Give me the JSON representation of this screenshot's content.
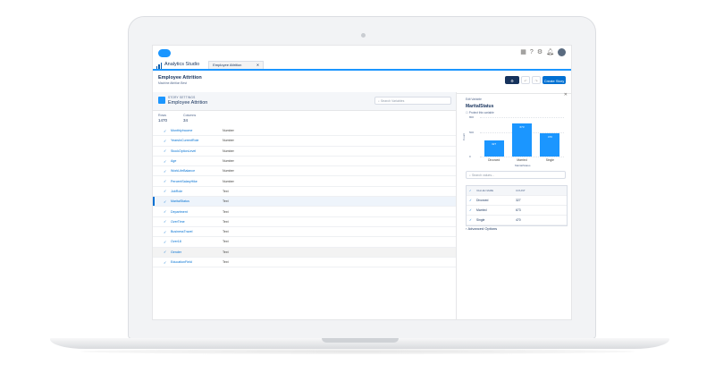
{
  "app": {
    "title": "Analytics Studio",
    "tab_label": "Employee Attrition",
    "tab_close": "✕",
    "icons": [
      "app-launcher-icon",
      "help-icon",
      "gear-icon",
      "bell-icon",
      "avatar"
    ]
  },
  "header": {
    "title": "Employee Attrition",
    "subtitle": "Machine Attrition Best",
    "buttons": [
      "",
      "",
      "",
      "Create Story"
    ]
  },
  "story": {
    "label": "STORY SETTINGS",
    "title": "Employee Attrition",
    "search_placeholder": "Search Variables"
  },
  "stats": {
    "rows_label": "Rows",
    "rows_value": "1470",
    "columns_label": "Columns",
    "columns_value": "34"
  },
  "variables": [
    {
      "name": "MonthlyIncome",
      "type": "Number"
    },
    {
      "name": "YearsInCurrentRole",
      "type": "Number"
    },
    {
      "name": "StockOptionLevel",
      "type": "Number"
    },
    {
      "name": "Age",
      "type": "Number"
    },
    {
      "name": "WorkLifeBalance",
      "type": "Number"
    },
    {
      "name": "PercentSalaryHike",
      "type": "Number"
    },
    {
      "name": "JobRole",
      "type": "Text"
    },
    {
      "name": "MaritalStatus",
      "type": "Text"
    },
    {
      "name": "Department",
      "type": "Text"
    },
    {
      "name": "OverTime",
      "type": "Text"
    },
    {
      "name": "BusinessTravel",
      "type": "Text"
    },
    {
      "name": "Over18",
      "type": "Text"
    },
    {
      "name": "Gender",
      "type": "Text"
    },
    {
      "name": "EducationField",
      "type": "Text"
    }
  ],
  "selected_index": 7,
  "highlighted_index": 12,
  "panel": {
    "label": "Edit Variable",
    "name": "MaritalStatus",
    "protect": "Protect this variable",
    "search_placeholder": "Search values...",
    "col_value": "VALUE NAME",
    "col_count": "COUNT",
    "advanced": "Advanced Options"
  },
  "chart_data": {
    "type": "bar",
    "categories": [
      "Divorced",
      "Married",
      "Single"
    ],
    "values": [
      327,
      673,
      470
    ],
    "ylim": [
      0,
      800
    ],
    "yticks": [
      0,
      500,
      800
    ],
    "ylabel": "Count",
    "xlabel": "MaritalStatus"
  },
  "value_rows": [
    {
      "name": "Divorced",
      "count": "327"
    },
    {
      "name": "Married",
      "count": "673"
    },
    {
      "name": "Single",
      "count": "470"
    }
  ],
  "colors": {
    "accent": "#1b96ff",
    "primary": "#0070d2",
    "navy": "#16325c"
  }
}
